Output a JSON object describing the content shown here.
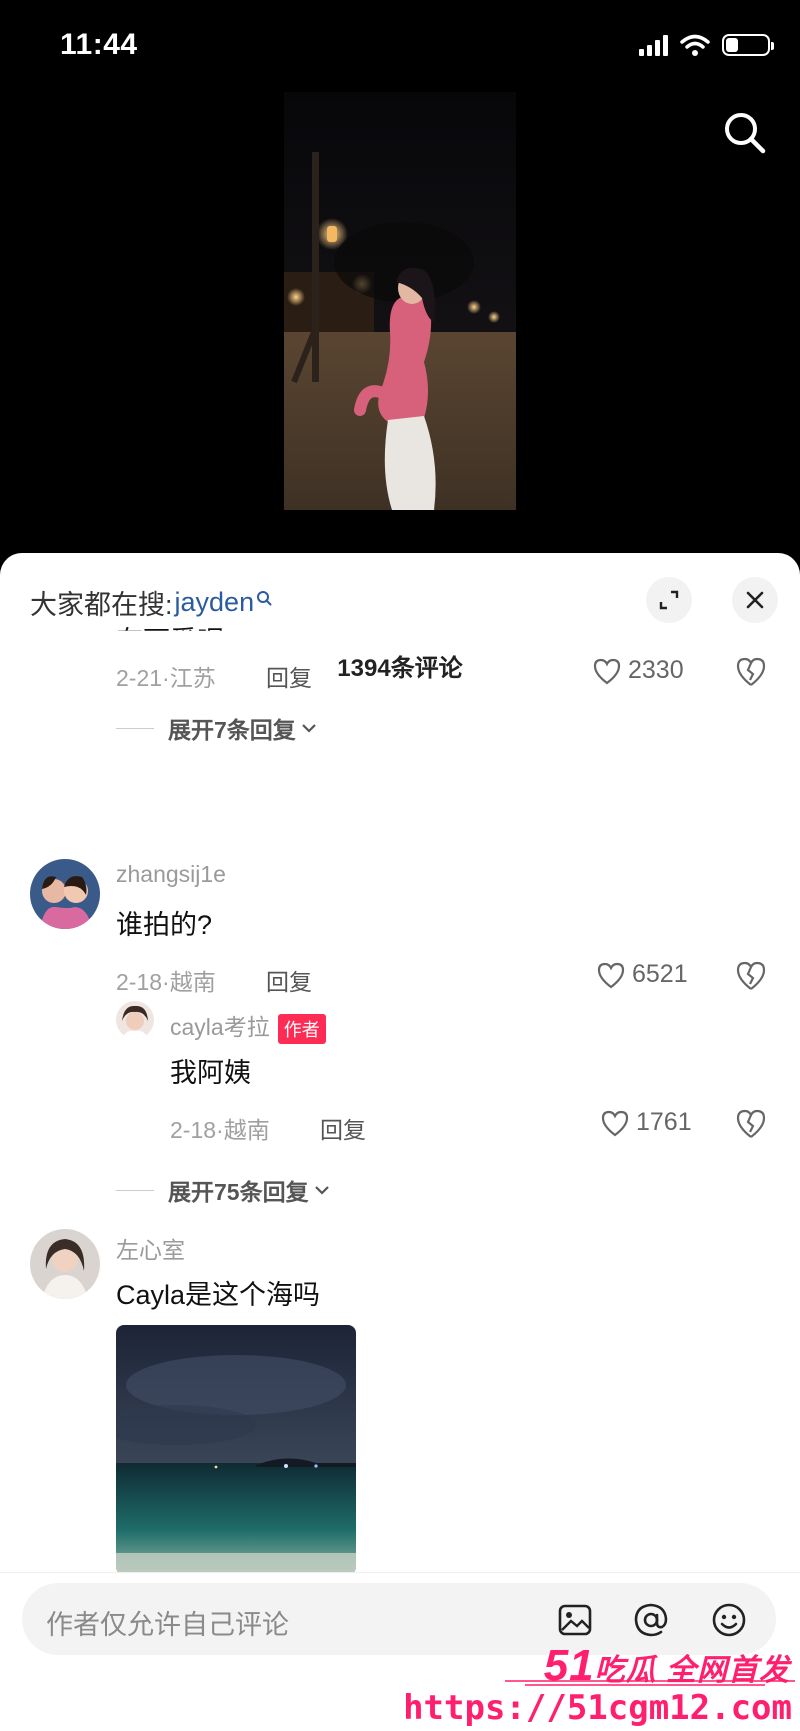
{
  "status_bar": {
    "time": "11:44"
  },
  "sheet": {
    "search_hint_prefix": "大家都在搜:",
    "search_keyword": "jayden",
    "comment_count": "1394条评论"
  },
  "comments": [
    {
      "partial_text": "有可爱呢",
      "date_location": "2-21·江苏",
      "reply_label": "回复",
      "likes": "2330",
      "expand_label": "展开7条回复"
    },
    {
      "username": "zhangsij1e",
      "text": "谁拍的?",
      "date_location": "2-18·越南",
      "reply_label": "回复",
      "likes": "6521",
      "reply": {
        "username": "cayla考拉",
        "badge": "作者",
        "text": "我阿姨",
        "date_location": "2-18·越南",
        "reply_label": "回复",
        "likes": "1761"
      },
      "expand_label": "展开75条回复"
    },
    {
      "username": "左心室",
      "text": "Cayla是这个海吗"
    }
  ],
  "input": {
    "placeholder": "作者仅允许自己评论"
  },
  "watermark": {
    "brand_num": "51",
    "brand_text": "吃瓜 全网首发",
    "url": "https://51cgm12.com"
  },
  "colors": {
    "author_badge": "#fe2c55",
    "keyword": "#2c5aa0",
    "watermark": "#ff1f6e"
  }
}
